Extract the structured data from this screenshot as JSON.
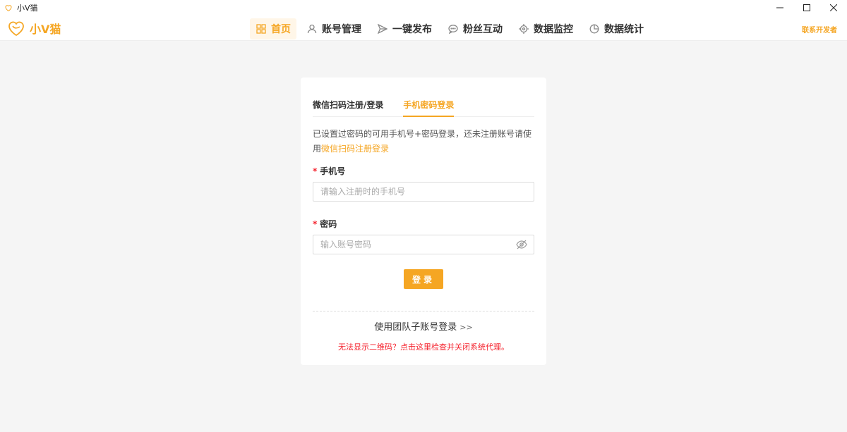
{
  "window": {
    "title": "小V猫",
    "controls": {
      "minimize": "—",
      "maximize": "☐",
      "close": "✕"
    }
  },
  "brand": {
    "name": "小V猫",
    "color": "#f5a623"
  },
  "nav": {
    "items": [
      {
        "label": "首页",
        "icon": "grid-icon",
        "active": true
      },
      {
        "label": "账号管理",
        "icon": "user-icon"
      },
      {
        "label": "一键发布",
        "icon": "send-icon"
      },
      {
        "label": "粉丝互动",
        "icon": "chat-icon"
      },
      {
        "label": "数据监控",
        "icon": "target-icon"
      },
      {
        "label": "数据统计",
        "icon": "pie-chart-icon"
      }
    ],
    "contact": "联系开发者"
  },
  "login": {
    "tabs": [
      {
        "label": "微信扫码注册/登录"
      },
      {
        "label": "手机密码登录",
        "active": true
      }
    ],
    "intro_text": "已设置过密码的可用手机号+密码登录，还未注册账号请使用",
    "intro_link": "微信扫码注册登录",
    "phone_label": "手机号",
    "phone_placeholder": "请输入注册时的手机号",
    "password_label": "密码",
    "password_placeholder": "输入账号密码",
    "required_mark": "*",
    "submit_label": "登录",
    "team_login": "使用团队子账号登录",
    "team_login_arrows": ">>",
    "qr_help": "无法显示二维码？点击这里检查并关闭系统代理。"
  },
  "colors": {
    "accent": "#f5a623",
    "error": "#f5222d",
    "background": "#f5f5f5"
  }
}
